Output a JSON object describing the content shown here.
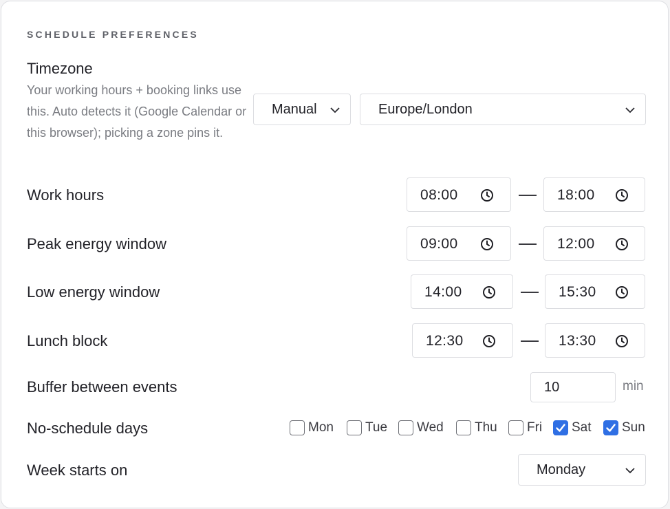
{
  "section": {
    "title": "SCHEDULE PREFERENCES"
  },
  "timezone": {
    "label": "Timezone",
    "description": "Your working hours + booking links use this. Auto detects it (Google Calendar or this browser); picking a zone pins it.",
    "mode_value": "Manual",
    "zone_value": "Europe/London"
  },
  "work_hours": {
    "label": "Work hours",
    "start": "08:00",
    "end": "18:00"
  },
  "peak_energy": {
    "label": "Peak energy window",
    "start": "09:00",
    "end": "12:00"
  },
  "low_energy": {
    "label": "Low energy window",
    "start": "14:00",
    "end": "15:30"
  },
  "lunch": {
    "label": "Lunch block",
    "start": "12:30",
    "end": "13:30"
  },
  "buffer": {
    "label": "Buffer between events",
    "value": "10",
    "unit": "min"
  },
  "no_schedule": {
    "label": "No-schedule days",
    "days": [
      {
        "label": "Mon",
        "checked": false
      },
      {
        "label": "Tue",
        "checked": false
      },
      {
        "label": "Wed",
        "checked": false
      },
      {
        "label": "Thu",
        "checked": false
      },
      {
        "label": "Fri",
        "checked": false
      },
      {
        "label": "Sat",
        "checked": true
      },
      {
        "label": "Sun",
        "checked": true
      }
    ]
  },
  "week_start": {
    "label": "Week starts on",
    "value": "Monday"
  },
  "colors": {
    "accent": "#2f6fe4",
    "border": "#dcdde1",
    "muted_text": "#7a7c82"
  },
  "icons": {
    "time": "clock-icon",
    "dropdown": "chevron-down-icon",
    "check": "checkmark-icon"
  }
}
